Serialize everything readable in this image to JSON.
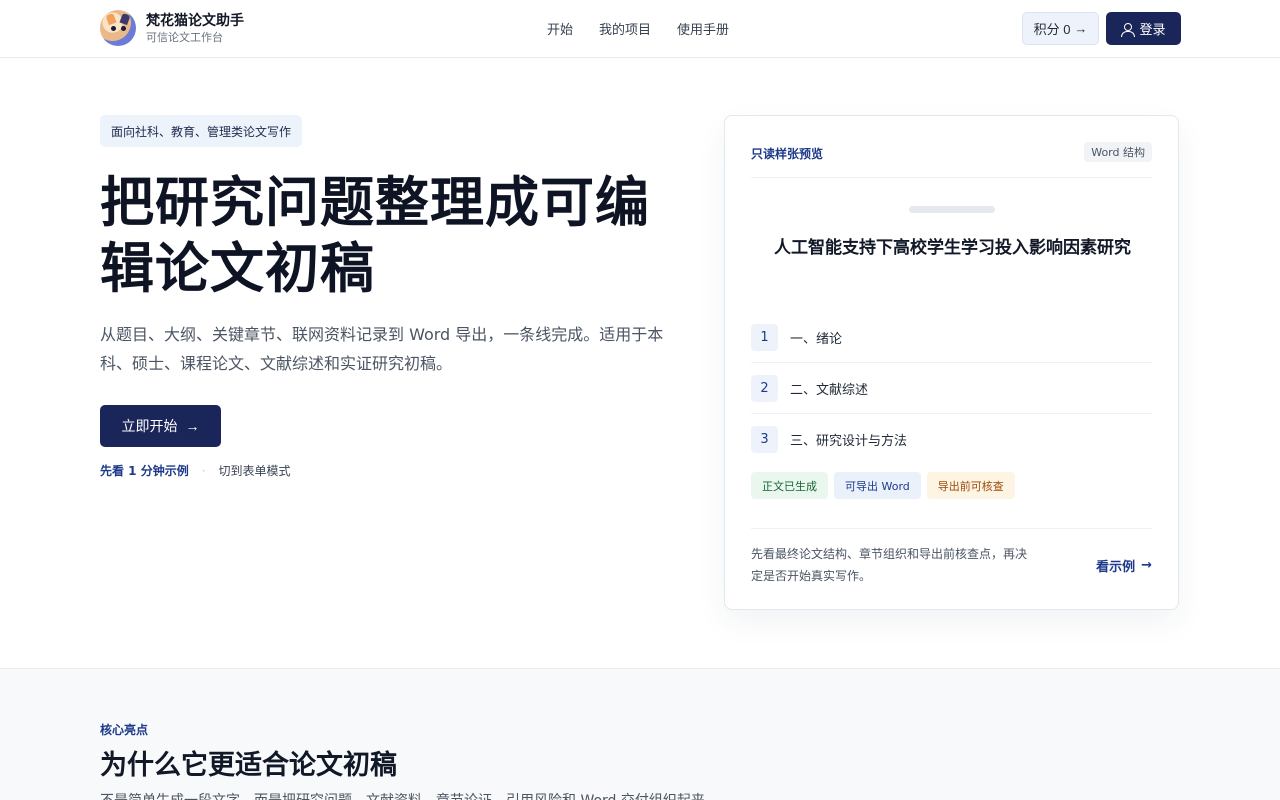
{
  "header": {
    "brand_name": "梵花猫论文助手",
    "brand_sub": "可信论文工作台",
    "nav": [
      "开始",
      "我的项目",
      "使用手册"
    ],
    "points_label": "积分 0",
    "points_arrow": "→",
    "login_label": "登录"
  },
  "hero": {
    "tag": "面向社科、教育、管理类论文写作",
    "title": "把研究问题整理成可编辑论文初稿",
    "description": "从题目、大纲、关键章节、联网资料记录到 Word 导出，一条线完成。适用于本科、硕士、课程论文、文献综述和实证研究初稿。",
    "start_label": "立即开始",
    "start_arrow": "→",
    "example_link": "先看 1 分钟示例",
    "separator": "·",
    "form_mode_link": "切到表单模式"
  },
  "preview": {
    "label": "只读样张预览",
    "badge": "Word 结构",
    "doc_title": "人工智能支持下高校学生学习投入影响因素研究",
    "chapters": [
      {
        "num": "1",
        "text": "一、绪论"
      },
      {
        "num": "2",
        "text": "二、文献综述"
      },
      {
        "num": "3",
        "text": "三、研究设计与方法"
      }
    ],
    "pills": [
      "正文已生成",
      "可导出 Word",
      "导出前可核查"
    ],
    "footer_text": "先看最终论文结构、章节组织和导出前核查点，再决定是否开始真实写作。",
    "footer_link": "看示例",
    "footer_arrow": "→"
  },
  "highlights": {
    "kicker": "核心亮点",
    "title": "为什么它更适合论文初稿",
    "description": "不是简单生成一段文字，而是把研究问题、文献资料、章节论证、引用风险和 Word 交付组织起来。"
  },
  "colors": {
    "primary": "#1a2659",
    "accent_text": "#1e3a8a",
    "tag_bg": "#edf3fb"
  }
}
